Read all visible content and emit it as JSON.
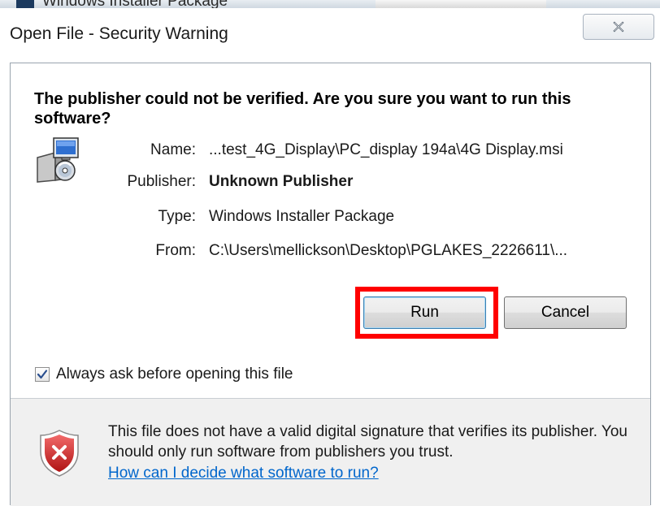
{
  "background_window": {
    "title": "Windows Installer Package"
  },
  "dialog": {
    "title": "Open File - Security Warning",
    "close_icon": "close-icon",
    "headline": "The publisher could not be verified.  Are you sure you want to run this software?",
    "fields": {
      "name_label": "Name:",
      "name_value": "...test_4G_Display\\PC_display 194a\\4G Display.msi",
      "publisher_label": "Publisher:",
      "publisher_value": "Unknown Publisher",
      "type_label": "Type:",
      "type_value": "Windows Installer Package",
      "from_label": "From:",
      "from_value": "C:\\Users\\mellickson\\Desktop\\PGLAKES_2226611\\..."
    },
    "buttons": {
      "run_label": "Run",
      "cancel_label": "Cancel"
    },
    "checkbox": {
      "label": "Always ask before opening this file",
      "checked": true
    },
    "footer": {
      "warning_text": "This file does not have a valid digital signature that verifies its publisher.  You should only run software from publishers you trust.",
      "link_text": "How can I decide what software to run?"
    }
  },
  "icons": [
    "installer-package-icon",
    "close-icon",
    "checkmark-icon",
    "security-shield-icon"
  ],
  "colors": {
    "highlight": "#ff0000",
    "link": "#0066cc",
    "shield_red": "#d42020"
  }
}
